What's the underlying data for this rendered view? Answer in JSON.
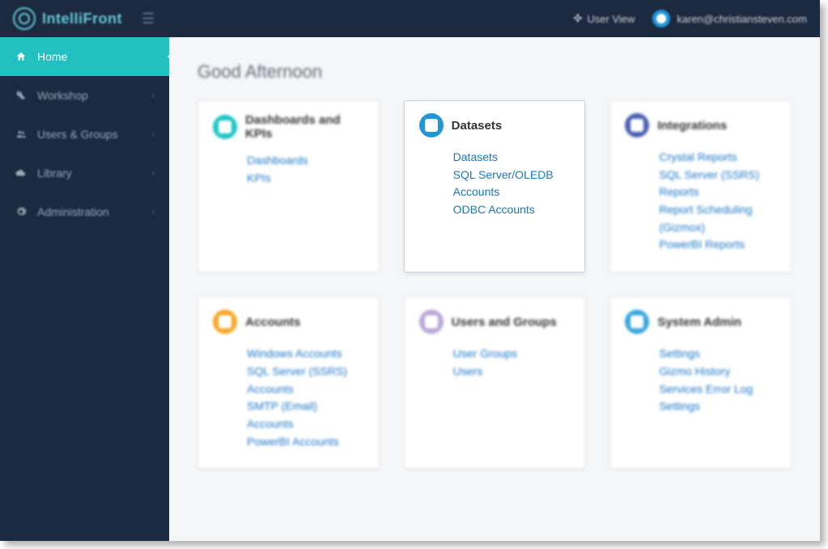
{
  "header": {
    "logo_text": "IntelliFront",
    "user_view_label": "User View",
    "user_email": "karen@christiansteven.com"
  },
  "sidebar": {
    "items": [
      {
        "label": "Home",
        "icon": "home-icon",
        "active": true
      },
      {
        "label": "Workshop",
        "icon": "wrench-icon",
        "expandable": true
      },
      {
        "label": "Users & Groups",
        "icon": "users-icon",
        "expandable": true
      },
      {
        "label": "Library",
        "icon": "cloud-icon",
        "expandable": true
      },
      {
        "label": "Administration",
        "icon": "gear-icon",
        "expandable": true
      }
    ]
  },
  "main": {
    "greeting": "Good Afternoon",
    "cards": [
      {
        "title": "Dashboards and KPIs",
        "icon_color": "teal",
        "focused": false,
        "links": [
          "Dashboards",
          "KPIs"
        ]
      },
      {
        "title": "Datasets",
        "icon_color": "blue",
        "focused": true,
        "links": [
          "Datasets",
          "SQL Server/OLEDB Accounts",
          "ODBC Accounts"
        ]
      },
      {
        "title": "Integrations",
        "icon_color": "indigo",
        "focused": false,
        "links": [
          "Crystal Reports",
          "SQL Server (SSRS) Reports",
          "Report Scheduling (Gizmox)",
          "PowerBI Reports"
        ]
      },
      {
        "title": "Accounts",
        "icon_color": "orange",
        "focused": false,
        "links": [
          "Windows Accounts",
          "SQL Server (SSRS) Accounts",
          "SMTP (Email) Accounts",
          "PowerBI Accounts"
        ]
      },
      {
        "title": "Users and Groups",
        "icon_color": "lilac",
        "focused": false,
        "links": [
          "User Groups",
          "Users"
        ]
      },
      {
        "title": "System Admin",
        "icon_color": "cyan",
        "focused": false,
        "links": [
          "Settings",
          "Gizmo History",
          "Services Error Log",
          "Settings"
        ]
      }
    ]
  }
}
